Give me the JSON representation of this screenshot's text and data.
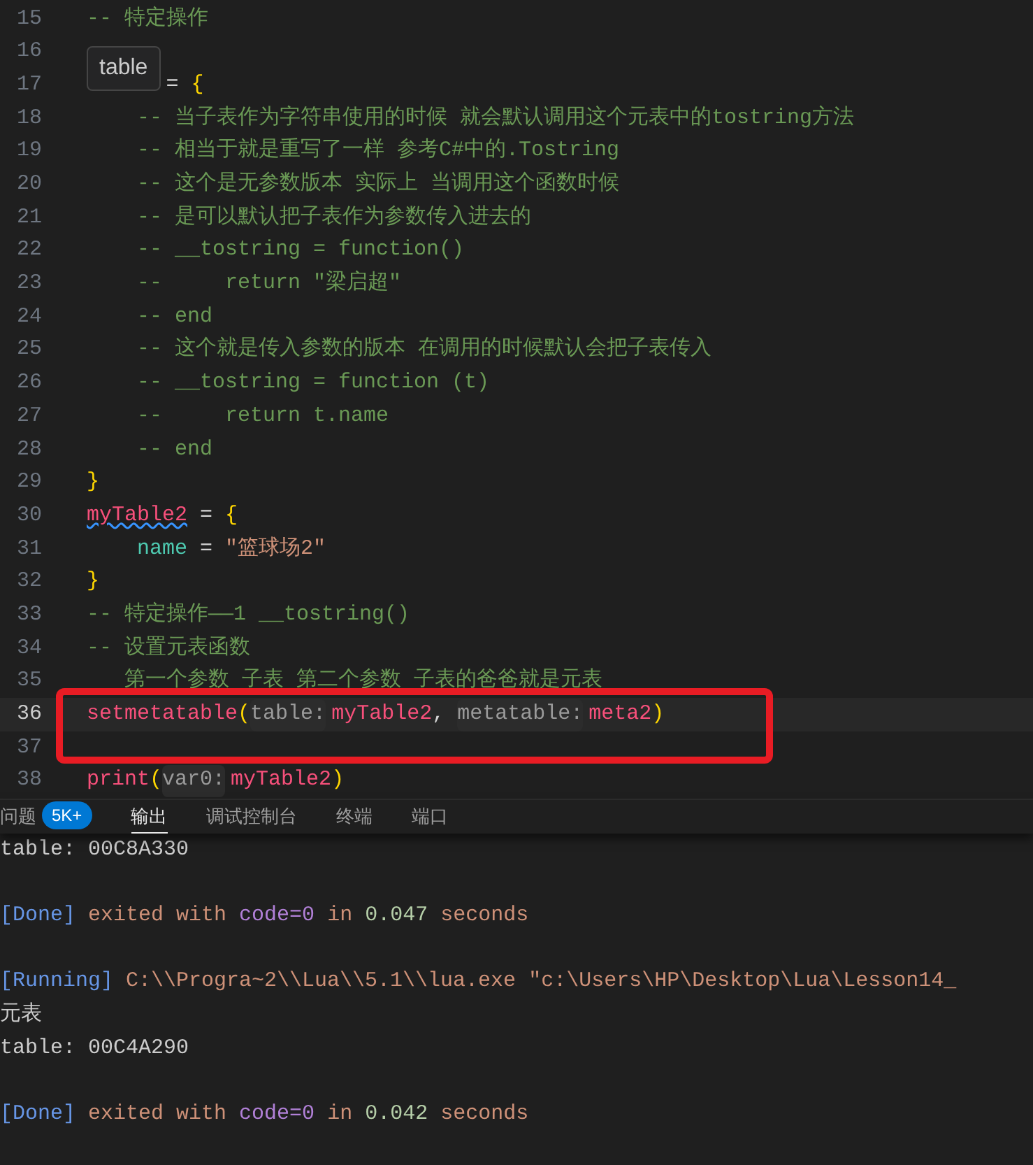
{
  "editor": {
    "lines": [
      {
        "number": "15",
        "current": false,
        "tokens": [
          {
            "kind": "comment",
            "text": "-- 特定操作"
          }
        ]
      },
      {
        "number": "16",
        "current": false
      },
      {
        "number": "17",
        "current": false,
        "tooltip": {
          "text": "table"
        },
        "tokens": [
          {
            "kind": "op",
            "text": "= "
          },
          {
            "kind": "brace",
            "text": "{"
          }
        ]
      },
      {
        "number": "18",
        "current": false,
        "tokens": [
          {
            "kind": "comment",
            "text": "    -- 当子表作为字符串使用的时候 就会默认调用这个元表中的tostring方法"
          }
        ]
      },
      {
        "number": "19",
        "current": false,
        "tokens": [
          {
            "kind": "comment",
            "text": "    -- 相当于就是重写了一样 参考C#中的.Tostring"
          }
        ]
      },
      {
        "number": "20",
        "current": false,
        "tokens": [
          {
            "kind": "comment",
            "text": "    -- 这个是无参数版本 实际上 当调用这个函数时候"
          }
        ]
      },
      {
        "number": "21",
        "current": false,
        "tokens": [
          {
            "kind": "comment",
            "text": "    -- 是可以默认把子表作为参数传入进去的"
          }
        ]
      },
      {
        "number": "22",
        "current": false,
        "tokens": [
          {
            "kind": "comment",
            "text": "    -- __tostring = function()"
          }
        ]
      },
      {
        "number": "23",
        "current": false,
        "tokens": [
          {
            "kind": "comment",
            "text": "    --     return \"梁启超\""
          }
        ]
      },
      {
        "number": "24",
        "current": false,
        "tokens": [
          {
            "kind": "comment",
            "text": "    -- end"
          }
        ]
      },
      {
        "number": "25",
        "current": false,
        "tokens": [
          {
            "kind": "comment",
            "text": "    -- 这个就是传入参数的版本 在调用的时候默认会把子表传入"
          }
        ]
      },
      {
        "number": "26",
        "current": false,
        "tokens": [
          {
            "kind": "comment",
            "text": "    -- __tostring = function (t)"
          }
        ]
      },
      {
        "number": "27",
        "current": false,
        "tokens": [
          {
            "kind": "comment",
            "text": "    --     return t.name"
          }
        ]
      },
      {
        "number": "28",
        "current": false,
        "tokens": [
          {
            "kind": "comment",
            "text": "    -- end"
          }
        ]
      },
      {
        "number": "29",
        "current": false,
        "tokens": [
          {
            "kind": "brace",
            "text": "}"
          }
        ]
      },
      {
        "number": "30",
        "current": false,
        "tokens": [
          {
            "kind": "ident",
            "text": "myTable2",
            "squiggle": true
          },
          {
            "kind": "op",
            "text": " = "
          },
          {
            "kind": "brace",
            "text": "{"
          }
        ]
      },
      {
        "number": "31",
        "current": false,
        "tokens": [
          {
            "kind": "field",
            "text": "    name"
          },
          {
            "kind": "op",
            "text": " = "
          },
          {
            "kind": "string",
            "text": "\"篮球场2\""
          }
        ]
      },
      {
        "number": "32",
        "current": false,
        "tokens": [
          {
            "kind": "brace",
            "text": "}"
          }
        ]
      },
      {
        "number": "33",
        "current": false,
        "tokens": [
          {
            "kind": "comment",
            "text": "-- 特定操作——1 __tostring()"
          }
        ]
      },
      {
        "number": "34",
        "current": false,
        "tokens": [
          {
            "kind": "comment",
            "text": "-- 设置元表函数"
          }
        ]
      },
      {
        "number": "35",
        "current": false,
        "tokens": [
          {
            "kind": "comment",
            "text": "   第一个参数 子表 第二个参数 子表的爸爸就是元表"
          }
        ]
      },
      {
        "number": "36",
        "current": true,
        "tokens": [
          {
            "kind": "ident",
            "text": "setmetatable"
          },
          {
            "kind": "brace",
            "text": "("
          },
          {
            "kind": "hint",
            "text": "table:"
          },
          {
            "kind": "ident",
            "text": "myTable2"
          },
          {
            "kind": "op",
            "text": ", "
          },
          {
            "kind": "hint",
            "text": "metatable:"
          },
          {
            "kind": "ident",
            "text": "meta2"
          },
          {
            "kind": "brace",
            "text": ")"
          }
        ]
      },
      {
        "number": "37",
        "current": false
      },
      {
        "number": "38",
        "current": false,
        "tokens": [
          {
            "kind": "ident",
            "text": "print"
          },
          {
            "kind": "brace",
            "text": "("
          },
          {
            "kind": "hint",
            "text": "var0:"
          },
          {
            "kind": "ident",
            "text": "myTable2"
          },
          {
            "kind": "brace",
            "text": ")"
          }
        ]
      }
    ]
  },
  "panel": {
    "tabs": [
      {
        "label": "问题",
        "badge": "5K+",
        "selected": false
      },
      {
        "label": "输出",
        "selected": true
      },
      {
        "label": "调试控制台",
        "selected": false
      },
      {
        "label": "终端",
        "selected": false
      },
      {
        "label": "端口",
        "selected": false
      }
    ],
    "output_blocks": [
      {
        "lines": [
          {
            "tokens": [
              {
                "kind": "plain",
                "text": "table: 00C8A330"
              }
            ]
          }
        ]
      },
      {
        "lines": [
          {
            "tokens": [
              {
                "kind": "tag",
                "text": "[Done]"
              },
              {
                "kind": "text",
                "text": " exited with "
              },
              {
                "kind": "keyword",
                "text": "code=0"
              },
              {
                "kind": "text",
                "text": " in "
              },
              {
                "kind": "number",
                "text": "0.047"
              },
              {
                "kind": "text",
                "text": " seconds"
              }
            ]
          }
        ]
      },
      {
        "lines": [
          {
            "tokens": [
              {
                "kind": "tag",
                "text": "[Running]"
              },
              {
                "kind": "text",
                "text": " C:\\\\Progra~2\\\\Lua\\\\5.1\\\\lua.exe \"c:\\Users\\HP\\Desktop\\Lua\\Lesson14_"
              }
            ]
          },
          {
            "tokens": [
              {
                "kind": "plain",
                "text": "元表"
              }
            ]
          },
          {
            "tokens": [
              {
                "kind": "plain",
                "text": "table: 00C4A290"
              }
            ]
          }
        ]
      },
      {
        "lines": [
          {
            "tokens": [
              {
                "kind": "tag",
                "text": "[Done]"
              },
              {
                "kind": "text",
                "text": " exited with "
              },
              {
                "kind": "keyword",
                "text": "code=0"
              },
              {
                "kind": "text",
                "text": " in "
              },
              {
                "kind": "number",
                "text": "0.042"
              },
              {
                "kind": "text",
                "text": " seconds"
              }
            ]
          }
        ]
      }
    ]
  }
}
